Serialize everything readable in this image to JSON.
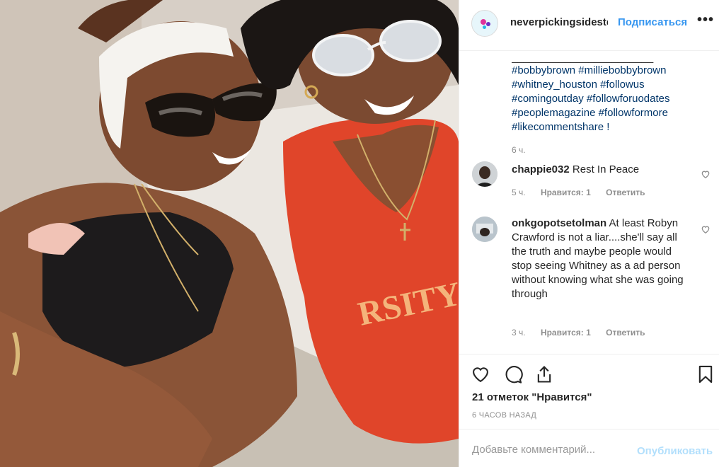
{
  "header": {
    "username": "neverpickingsideste",
    "follow_label": "Подписаться",
    "more_label": "•••"
  },
  "caption": {
    "separator": "________________________",
    "lines": [
      "#bobbybrown #milliebobbybrown",
      "#whitney_houston #followus",
      "#comingoutday #followforuodates",
      "#peoplemagazine #followformore",
      "#likecommentshare !"
    ],
    "time": "6 ч."
  },
  "comments": [
    {
      "user": "chappie032",
      "text": "Rest In Peace",
      "time": "5 ч.",
      "likes": "Нравится: 1",
      "reply": "Ответить"
    },
    {
      "user": "onkgopotsetolman",
      "text": "At least Robyn Crawford is not a liar....she'll say all the truth and maybe people would stop seeing Whitney as a ad person without knowing what she was going through",
      "time": "3 ч.",
      "likes": "Нравится: 1",
      "reply": "Ответить"
    }
  ],
  "actions": {
    "likes_text": "21 отметок \"Нравится\"",
    "posted_text": "6 ЧАСОВ НАЗАД"
  },
  "add_comment": {
    "placeholder": "Добавьте комментарий...",
    "publish_label": "Опубликовать"
  },
  "colors": {
    "accent": "#3897f0",
    "hashtag": "#003569",
    "muted": "#8e8e8e",
    "publish_disabled": "#b2dffc"
  },
  "icons": [
    "heart-icon",
    "comment-icon",
    "share-icon",
    "bookmark-icon",
    "more-options-icon",
    "comment-like-heart-icon"
  ]
}
